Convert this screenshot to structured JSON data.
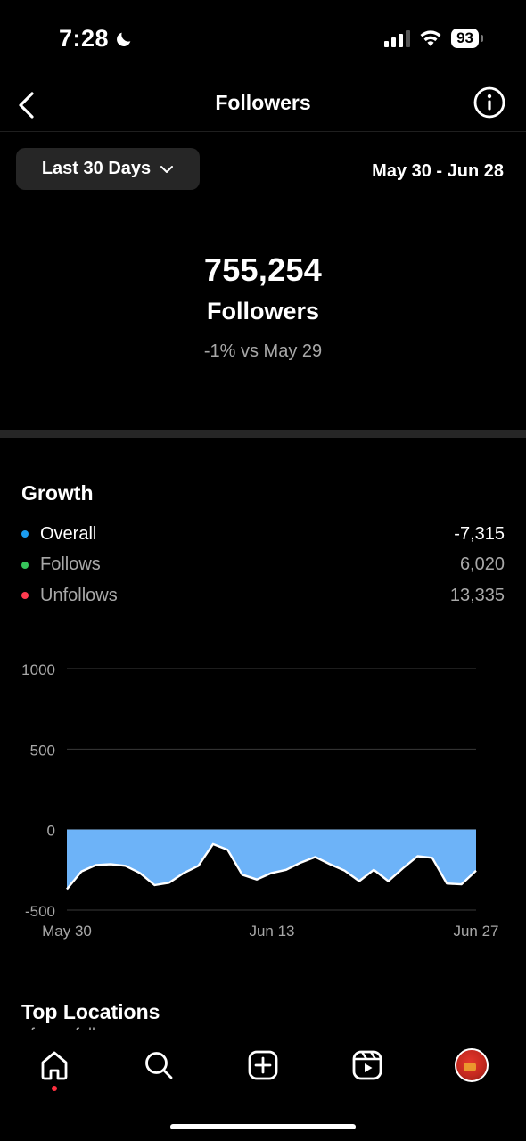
{
  "status_bar": {
    "time": "7:28",
    "battery": "93",
    "moon_icon": "moon-icon",
    "signal_icon": "cellular-signal-icon",
    "wifi_icon": "wifi-icon"
  },
  "header": {
    "title": "Followers",
    "back_icon": "chevron-left-icon",
    "info_icon": "info-icon"
  },
  "filter": {
    "range_label": "Last 30 Days",
    "dropdown_icon": "chevron-down-icon",
    "date_range": "May 30 - Jun 28"
  },
  "summary": {
    "total": "755,254",
    "label": "Followers",
    "delta": "-1% vs May 29"
  },
  "growth": {
    "title": "Growth",
    "legend": [
      {
        "label": "Overall",
        "value": "-7,315",
        "color": "#1a9cf0"
      },
      {
        "label": "Follows",
        "value": "6,020",
        "color": "#36c45a"
      },
      {
        "label": "Unfollows",
        "value": "13,335",
        "color": "#ff3b4f"
      }
    ]
  },
  "chart_data": {
    "type": "area",
    "x_tick_labels": [
      "May 30",
      "Jun 13",
      "Jun 27"
    ],
    "y_ticks": [
      1000,
      500,
      0,
      -500
    ],
    "ylim": [
      -500,
      1000
    ],
    "grid": true,
    "fill_color": "#6db3f8",
    "series": [
      {
        "values": [
          -370,
          -260,
          -220,
          -215,
          -225,
          -270,
          -345,
          -330,
          -270,
          -225,
          -90,
          -125,
          -280,
          -310,
          -270,
          -250,
          -205,
          -170,
          -215,
          -255,
          -320,
          -250,
          -320,
          -240,
          -165,
          -175,
          -335,
          -340,
          -255
        ]
      }
    ]
  },
  "locations": {
    "title": "Top Locations",
    "subtitle": "of your followers"
  },
  "bottom_nav": {
    "items": [
      {
        "name": "home-icon"
      },
      {
        "name": "search-icon"
      },
      {
        "name": "create-icon"
      },
      {
        "name": "reels-icon"
      },
      {
        "name": "profile-avatar"
      }
    ],
    "notification_color": "#ff3040"
  }
}
